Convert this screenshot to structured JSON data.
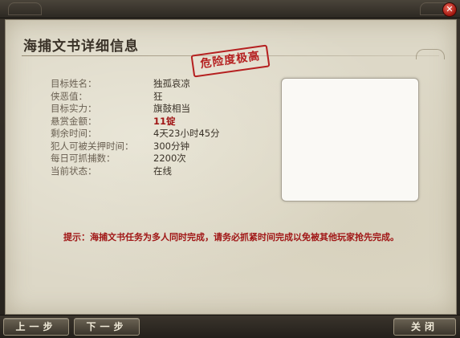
{
  "window": {
    "close_glyph": "✕",
    "title": "海捕文书详细信息",
    "stamp": "危险度极高"
  },
  "fields": [
    {
      "label": "目标姓名：",
      "value": "独孤哀凉"
    },
    {
      "label": "侠恶值：",
      "value": "狂"
    },
    {
      "label": "目标实力：",
      "value": "旗鼓相当"
    },
    {
      "label": "悬赏金额：",
      "value": "11锭",
      "highlight": true
    },
    {
      "label": "剩余时间：",
      "value": "4天23小时45分"
    },
    {
      "label": "犯人可被关押时间：",
      "value": "300分钟"
    },
    {
      "label": "每日可抓捕数：",
      "value": "2200次"
    },
    {
      "label": "当前状态：",
      "value": "在线"
    }
  ],
  "hint": "提示：海捕文书任务为多人同时完成，请务必抓紧时间完成以免被其他玩家抢先完成。",
  "buttons": {
    "prev": "上一步",
    "next": "下一步",
    "close": "关闭"
  },
  "colors": {
    "parchment": "#ddd8c7",
    "stamp_red": "#b52020",
    "hint_red": "#a01616"
  }
}
